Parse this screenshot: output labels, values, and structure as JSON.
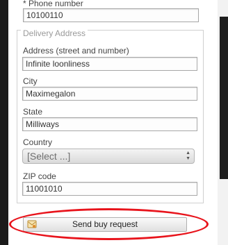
{
  "form": {
    "phone_label": "* Phone number",
    "phone_value": "10100110",
    "delivery_legend": "Delivery Address",
    "address_label": "Address (street and number)",
    "address_value": "Infinite loonliness",
    "city_label": "City",
    "city_value": "Maximegalon",
    "state_label": "State",
    "state_value": "Milliways",
    "country_label": "Country",
    "country_selected": "[Select ...]",
    "zip_label": "ZIP code",
    "zip_value": "11001010"
  },
  "submit": {
    "label": "Send buy request",
    "icon": "cart-icon"
  },
  "annotation": {
    "highlight_color": "#e8141c"
  }
}
